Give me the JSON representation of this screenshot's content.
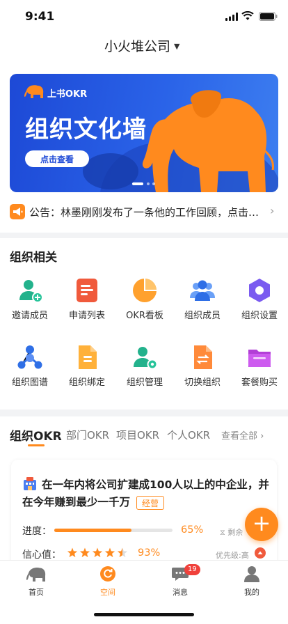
{
  "status_bar": {
    "time": "9:41"
  },
  "header": {
    "company": "小火堆公司",
    "caret": "▼"
  },
  "banner": {
    "brand": "上书OKR",
    "title": "组织文化墙",
    "button_label": "点击查看",
    "page_indicator": {
      "pages": 3,
      "active": 1
    }
  },
  "announcement": {
    "text": "公告：林墨刚刚发布了一条他的工作回顾，点击…",
    "chevron": "›"
  },
  "org_section": {
    "title": "组织相关",
    "items": [
      {
        "label": "邀请成员",
        "icon": "add-user-icon"
      },
      {
        "label": "申请列表",
        "icon": "list-icon"
      },
      {
        "label": "OKR看板",
        "icon": "pie-chart-icon"
      },
      {
        "label": "组织成员",
        "icon": "group-icon"
      },
      {
        "label": "组织设置",
        "icon": "gear-hexagon-icon"
      },
      {
        "label": "组织图谱",
        "icon": "network-graph-icon"
      },
      {
        "label": "组织绑定",
        "icon": "link-document-icon"
      },
      {
        "label": "组织管理",
        "icon": "user-settings-icon"
      },
      {
        "label": "切换组织",
        "icon": "switch-document-icon"
      },
      {
        "label": "套餐购买",
        "icon": "folder-icon"
      }
    ]
  },
  "okr_section": {
    "tabs": [
      "组织OKR",
      "部门OKR",
      "项目OKR",
      "个人OKR"
    ],
    "active_tab": 0,
    "view_all": "查看全部 ›",
    "card": {
      "title_line1": "在一年内将公司扩建成100人以上的中企业，并",
      "title_line2": "在今年赚到最少一千万",
      "tag": "经营",
      "progress_label": "进度：",
      "progress_value": 65,
      "progress_text": "65%",
      "remaining_label": "⧖ 剩余",
      "confidence_label": "信心值：",
      "confidence_stars": 4.5,
      "confidence_text": "93%",
      "priority_text": "优先级:高"
    }
  },
  "fab": {
    "label": "+"
  },
  "tabbar": {
    "items": [
      {
        "label": "首页",
        "icon": "elephant-icon"
      },
      {
        "label": "空间",
        "icon": "refresh-circle-icon"
      },
      {
        "label": "消息",
        "icon": "chat-icon"
      },
      {
        "label": "我的",
        "icon": "person-icon"
      }
    ],
    "active": 1,
    "badge": "19"
  },
  "colors": {
    "accent": "#ff8a1e",
    "banner_blue": "#2a63e8",
    "badge_red": "#f0413b"
  }
}
